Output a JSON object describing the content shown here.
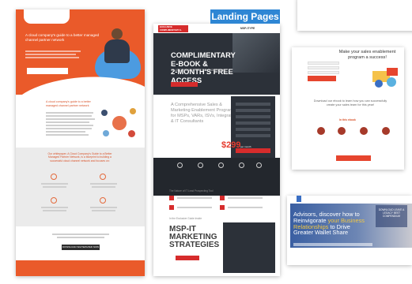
{
  "badge": {
    "label": "Landing Pages"
  },
  "left_page": {
    "hero_title": "A cloud company's guide to a better managed channel partner network",
    "section_title": "A cloud company's guide to a better managed channel partner network",
    "gray_title": "Our whitepaper, A Cloud Company's Guide to a Better Managed Partner Network, is a blueprint to building a successful cloud channel network and focuses on:",
    "cta_button": "DOWNLOAD WHITEPAPER NOW"
  },
  "middle_page": {
    "logo_text": "EXCLUSIVE COMPLIMENTARY E-BOOK",
    "nav_text": "MSP-ITYPE",
    "hero_title_line1": "COMPLIMENTARY",
    "hero_title_line2": "E-BOOK &",
    "hero_title_line3": "2-MONTH'S FREE ACCESS",
    "hero_sub": "TO LEAD PROSPECTING TOOL WORTH $1000",
    "body_text": "A Comprehensive Sales & Marketing Enablement Program for MSPs, VARs, ISVs, Integrators & IT Consultants",
    "price_label": "Great value starting at",
    "price": "$299",
    "price_tail": "per month",
    "section2_head": "The Nature of IT Lead Prospecting Tool",
    "section3_head": "In the Exclusive Guide Inside",
    "msp_title": "MSP-IT MARKETING STRATEGIES"
  },
  "right_top_page": {
    "title": "Make your sales enablement program a success!",
    "download_text": "Download our ebook to learn how you can successfully create your sales team for this year!",
    "inside_label": "In this ebook"
  },
  "right_bottom_page": {
    "hero_title_a": "Advisors, discover how to Reinvigorate",
    "hero_title_b": "your Business Relationships",
    "hero_title_c": "to Drive Greater Wallet Share",
    "download_box": "DOWNLOAD LEAVE A LEGACY BEST COMPENDIUM"
  }
}
